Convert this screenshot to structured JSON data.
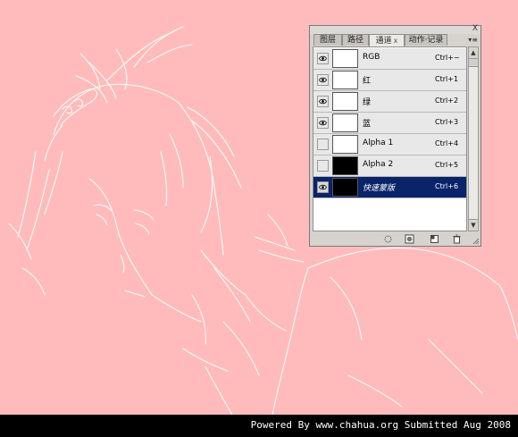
{
  "panel": {
    "close_glyph": "X",
    "menu_glyph": "▾≡",
    "tabs": [
      {
        "label": "图层",
        "active": false
      },
      {
        "label": "路径",
        "active": false
      },
      {
        "label": "通道",
        "active": true,
        "close": "x"
      },
      {
        "label": "动作·记录",
        "active": false
      }
    ],
    "channels": [
      {
        "label": "RGB",
        "shortcut": "Ctrl+~",
        "visible": true,
        "thumb": "white",
        "selected": false
      },
      {
        "label": "红",
        "shortcut": "Ctrl+1",
        "visible": true,
        "thumb": "white",
        "selected": false
      },
      {
        "label": "绿",
        "shortcut": "Ctrl+2",
        "visible": true,
        "thumb": "white",
        "selected": false
      },
      {
        "label": "蓝",
        "shortcut": "Ctrl+3",
        "visible": true,
        "thumb": "white",
        "selected": false
      },
      {
        "label": "Alpha 1",
        "shortcut": "Ctrl+4",
        "visible": false,
        "thumb": "white",
        "selected": false
      },
      {
        "label": "Alpha 2",
        "shortcut": "Ctrl+5",
        "visible": false,
        "thumb": "dark",
        "selected": false
      },
      {
        "label": "快速蒙版",
        "shortcut": "Ctrl+6",
        "visible": true,
        "thumb": "dark",
        "selected": true
      }
    ],
    "bottom_icons": [
      "dotted-circle-icon",
      "mask-circle-icon",
      "new-channel-icon",
      "trash-icon"
    ]
  },
  "footer": {
    "text": "Powered By www.chahua.org  Submitted Aug 2008"
  },
  "colors": {
    "background": "#ffbbbb",
    "line_art": "#ffffff",
    "selection": "#0a246a",
    "footer_bg": "#000000"
  }
}
